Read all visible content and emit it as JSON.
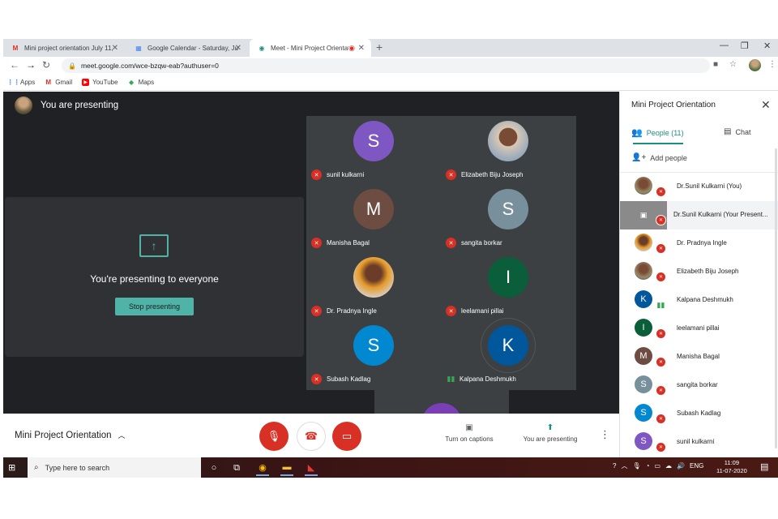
{
  "browser": {
    "tabs": [
      {
        "title": "Mini project orientation July 11,",
        "icon": "gmail-icon",
        "glyph": "M",
        "color": "#d93025"
      },
      {
        "title": "Google Calendar - Saturday, July",
        "icon": "calendar-icon",
        "glyph": "31",
        "color": "#4285f4"
      },
      {
        "title": "Meet - Mini Project Orientati",
        "icon": "meet-icon",
        "glyph": "●",
        "color": "#1a8e7f"
      }
    ],
    "url": "meet.google.com/wce-bzqw-eab?authuser=0",
    "bookmarks": [
      "Apps",
      "Gmail",
      "YouTube",
      "Maps"
    ]
  },
  "meet": {
    "presenting_header": "You are presenting",
    "present_message": "You're presenting to everyone",
    "stop_button": "Stop presenting",
    "tiles": [
      {
        "name": "sunil kulkarni",
        "initial": "S",
        "color": "#7e57c2",
        "muted": true
      },
      {
        "name": "Elizabeth Biju Joseph",
        "initial": "",
        "color": "",
        "muted": true,
        "photo": true
      },
      {
        "name": "Manisha Bagal",
        "initial": "M",
        "color": "#6d4c41",
        "muted": true
      },
      {
        "name": "sangita borkar",
        "initial": "S",
        "color": "#78909c",
        "muted": true
      },
      {
        "name": "Dr. Pradnya Ingle",
        "initial": "",
        "color": "",
        "muted": true,
        "photo": true
      },
      {
        "name": "leelamani pillai",
        "initial": "I",
        "color": "#0b5e3a",
        "muted": true
      },
      {
        "name": "Subash Kadlag",
        "initial": "S",
        "color": "#0288d1",
        "muted": true
      },
      {
        "name": "Kalpana Deshmukh",
        "initial": "K",
        "color": "#01579b",
        "muted": false
      }
    ],
    "meeting_name": "Mini Project Orientation",
    "captions_label": "Turn on captions",
    "presenting_label": "You are presenting"
  },
  "side_panel": {
    "title": "Mini Project Orientation",
    "people_tab": "People (11)",
    "chat_tab": "Chat",
    "add_people": "Add people",
    "people": [
      {
        "name": "Dr.Sunil Kulkarni (You)",
        "initial": "",
        "color": "",
        "muted": true
      },
      {
        "name": "Dr.Sunil Kulkarni (Your Present...",
        "initial": "",
        "color": "#8a8a8a",
        "muted": true
      },
      {
        "name": "Dr. Pradnya Ingle",
        "initial": "",
        "color": "",
        "muted": true
      },
      {
        "name": "Elizabeth Biju Joseph",
        "initial": "",
        "color": "",
        "muted": true
      },
      {
        "name": "Kalpana Deshmukh",
        "initial": "K",
        "color": "#01579b",
        "muted": false
      },
      {
        "name": "leelamani pillai",
        "initial": "I",
        "color": "#0b5e3a",
        "muted": true
      },
      {
        "name": "Manisha Bagal",
        "initial": "M",
        "color": "#6d4c41",
        "muted": true
      },
      {
        "name": "sangita borkar",
        "initial": "S",
        "color": "#78909c",
        "muted": true
      },
      {
        "name": "Subash Kadlag",
        "initial": "S",
        "color": "#0288d1",
        "muted": true
      },
      {
        "name": "sunil kulkarni",
        "initial": "S",
        "color": "#7e57c2",
        "muted": true
      }
    ]
  },
  "taskbar": {
    "search_placeholder": "Type here to search",
    "language": "ENG",
    "time": "11:09",
    "date": "11-07-2020"
  }
}
